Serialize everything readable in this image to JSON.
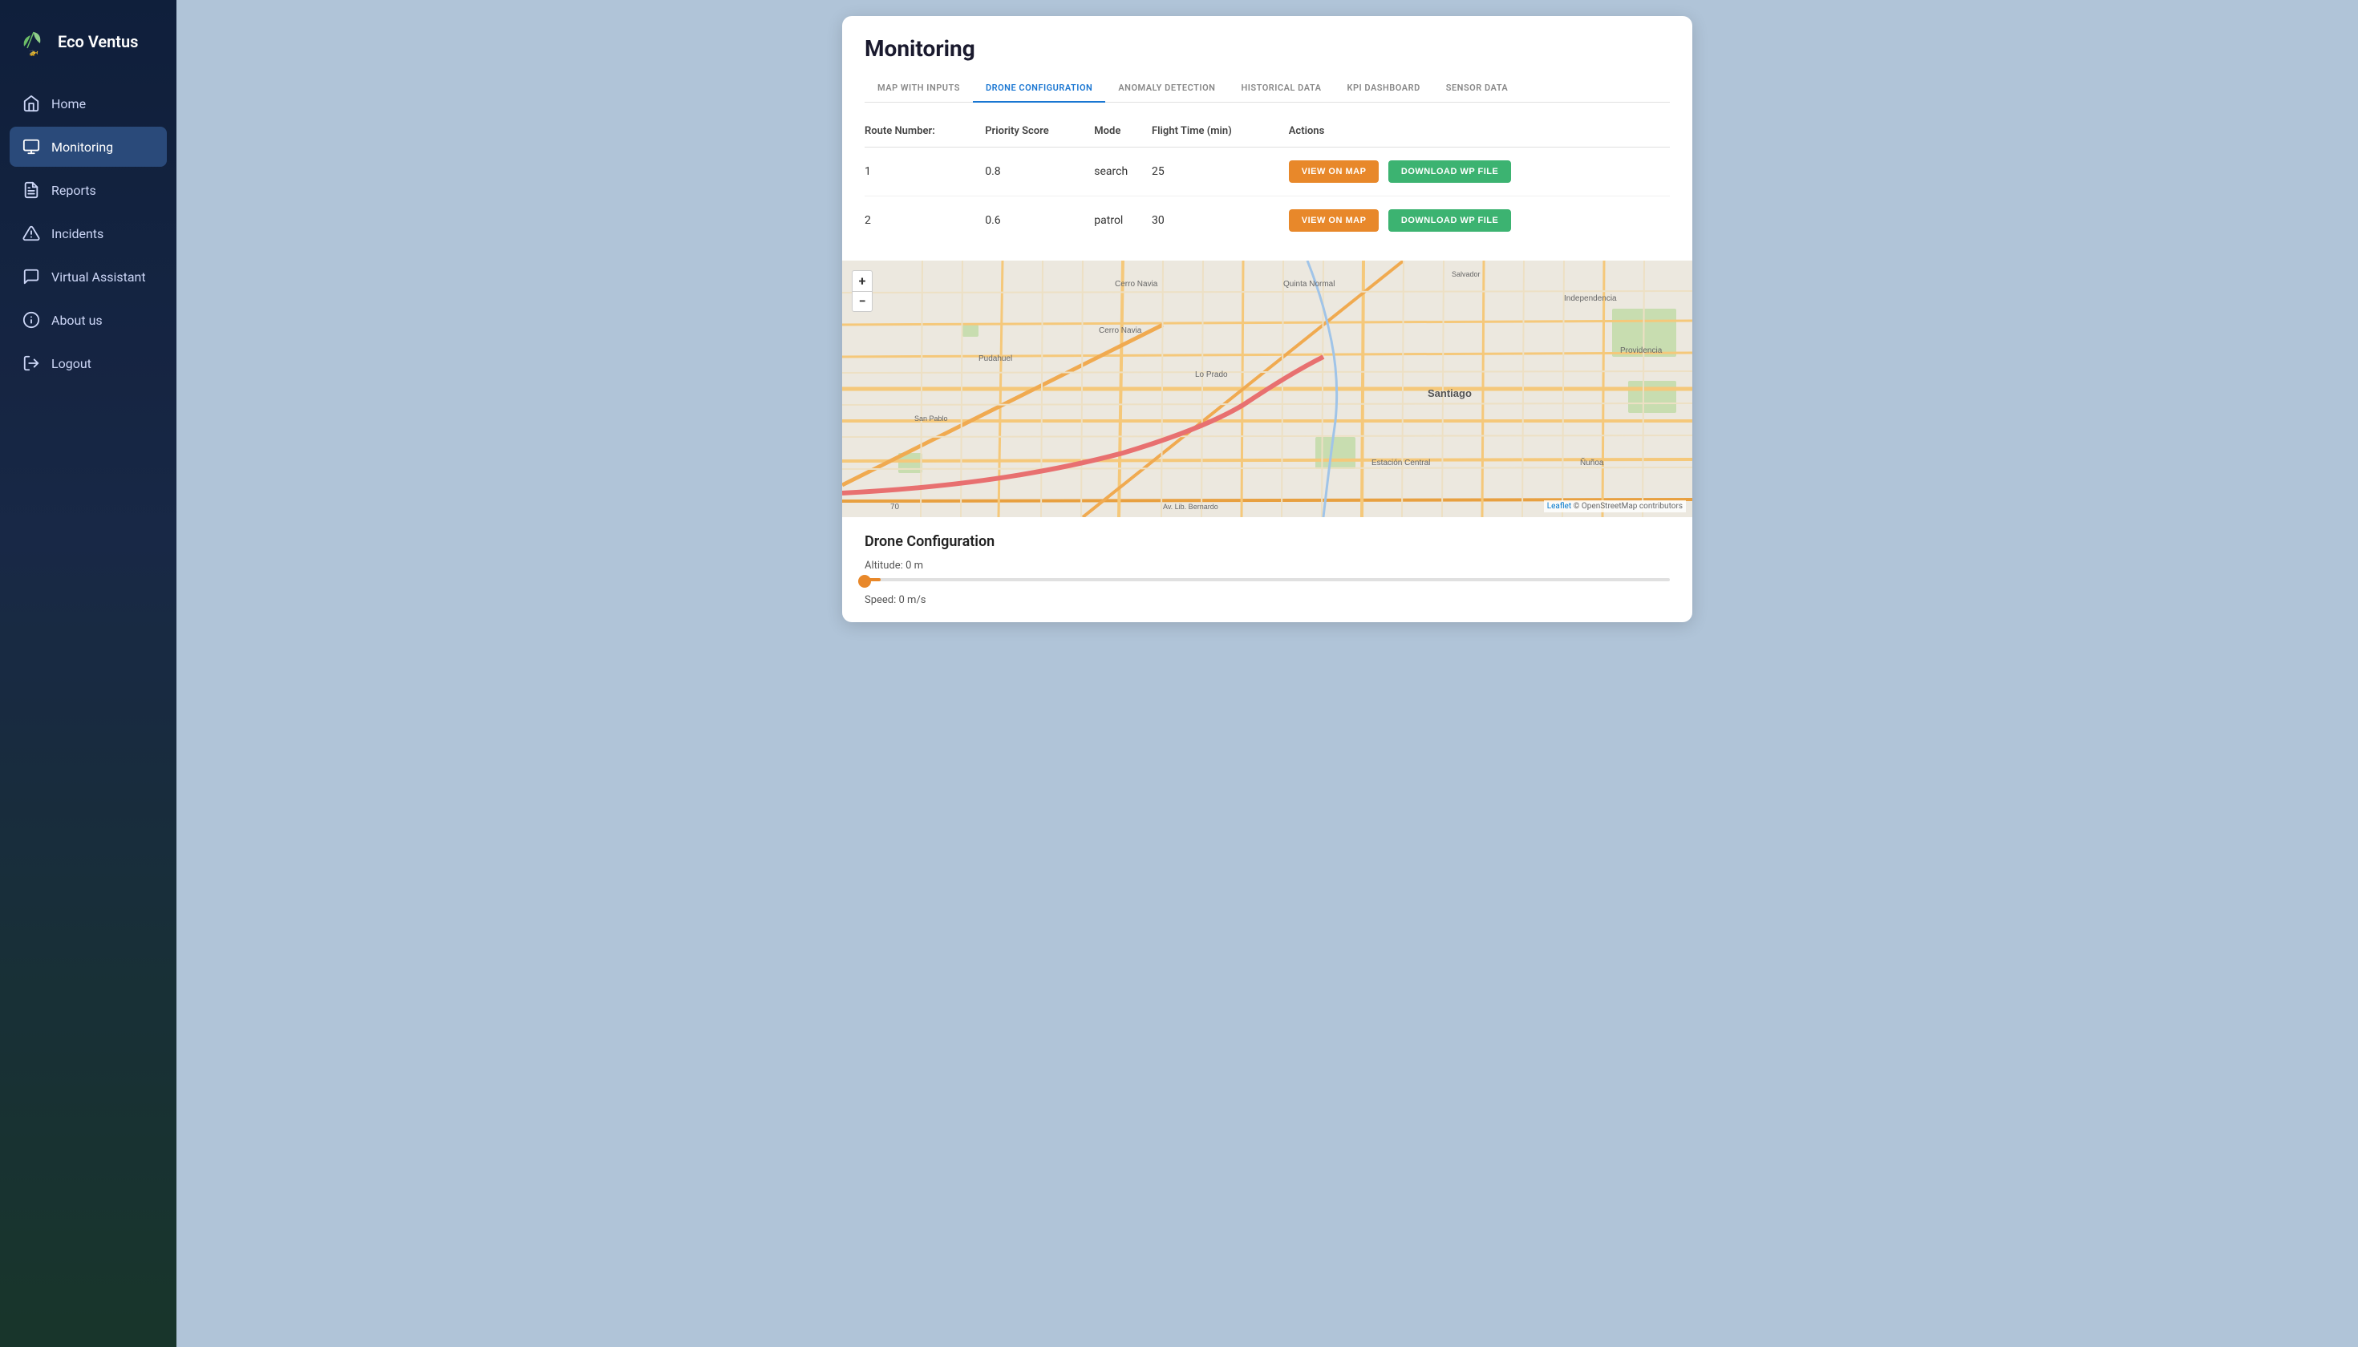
{
  "app": {
    "logo_text": "Eco Ventus"
  },
  "sidebar": {
    "items": [
      {
        "id": "home",
        "label": "Home",
        "active": false,
        "icon": "home"
      },
      {
        "id": "monitoring",
        "label": "Monitoring",
        "active": true,
        "icon": "monitoring"
      },
      {
        "id": "reports",
        "label": "Reports",
        "active": false,
        "icon": "reports"
      },
      {
        "id": "incidents",
        "label": "Incidents",
        "active": false,
        "icon": "incidents"
      },
      {
        "id": "virtual-assistant",
        "label": "Virtual Assistant",
        "active": false,
        "icon": "chat"
      },
      {
        "id": "about-us",
        "label": "About us",
        "active": false,
        "icon": "info"
      },
      {
        "id": "logout",
        "label": "Logout",
        "active": false,
        "icon": "logout"
      }
    ]
  },
  "panel": {
    "title": "Monitoring",
    "tabs": [
      {
        "id": "map-inputs",
        "label": "MAP WITH INPUTS",
        "active": false
      },
      {
        "id": "drone-config",
        "label": "DRONE CONFIGURATION",
        "active": true
      },
      {
        "id": "anomaly-detection",
        "label": "ANOMALY DETECTION",
        "active": false
      },
      {
        "id": "historical-data",
        "label": "HISTORICAL DATA",
        "active": false
      },
      {
        "id": "kpi-dashboard",
        "label": "KPI DASHBOARD",
        "active": false
      },
      {
        "id": "sensor-data",
        "label": "SENSOR DATA",
        "active": false
      }
    ],
    "table": {
      "headers": [
        "Route Number:",
        "Priority Score",
        "Mode",
        "Flight Time (min)",
        "Actions"
      ],
      "rows": [
        {
          "route": "1",
          "priority": "0.8",
          "mode": "search",
          "flight_time": "25",
          "btn_view": "VIEW ON MAP",
          "btn_download": "DOWNLOAD WP FILE"
        },
        {
          "route": "2",
          "priority": "0.6",
          "mode": "patrol",
          "flight_time": "30",
          "btn_view": "VIEW ON MAP",
          "btn_download": "DOWNLOAD WP FILE"
        }
      ]
    },
    "map": {
      "zoom_in": "+",
      "zoom_out": "−",
      "attribution_leaflet": "Leaflet",
      "attribution_osm": "© OpenStreetMap contributors"
    },
    "drone_config": {
      "title": "Drone Configuration",
      "altitude_label": "Altitude: 0 m",
      "speed_label": "Speed: 0 m/s",
      "altitude_value": 0,
      "speed_value": 0
    }
  },
  "colors": {
    "active_tab": "#1976d2",
    "btn_view": "#e8882a",
    "btn_download": "#3cb371",
    "nav_active_bg": "#2a4a7a",
    "slider_color": "#e8882a"
  }
}
